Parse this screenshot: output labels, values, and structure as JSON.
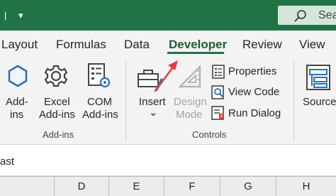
{
  "titlebar": {
    "qat_divider": "|",
    "qat_dropdown_glyph": "▾",
    "search_text": "Sea"
  },
  "tabs": [
    {
      "label": "Layout"
    },
    {
      "label": "Formulas"
    },
    {
      "label": "Data"
    },
    {
      "label": "Developer",
      "active": true
    },
    {
      "label": "Review"
    },
    {
      "label": "View"
    }
  ],
  "ribbon": {
    "addins_group": {
      "label": "Add-ins",
      "buttons": [
        {
          "line1": "Add-",
          "line2": "ins",
          "icon": "addins-hexagon-icon"
        },
        {
          "line1": "Excel",
          "line2": "Add-ins",
          "icon": "gear-icon"
        },
        {
          "line1": "COM",
          "line2": "Add-ins",
          "icon": "com-addins-icon"
        }
      ]
    },
    "controls_group": {
      "label": "Controls",
      "insert": {
        "label": "Insert",
        "dropdown_glyph": "⌄"
      },
      "design_mode": {
        "line1": "Design",
        "line2": "Mode",
        "enabled": false
      },
      "small_buttons": [
        {
          "label": "Properties",
          "icon": "properties-icon"
        },
        {
          "label": "View Code",
          "icon": "view-code-icon"
        },
        {
          "label": "Run Dialog",
          "icon": "run-dialog-icon"
        }
      ]
    },
    "xml_group": {
      "source": {
        "label": "Source",
        "icon": "source-icon"
      }
    }
  },
  "formula_bar": {
    "text": "ast"
  },
  "columns": [
    "D",
    "E",
    "F",
    "G",
    "H"
  ],
  "colors": {
    "brand_green": "#217346",
    "arrow_red": "#e03c3c",
    "icon_blue": "#2b6fb6"
  }
}
